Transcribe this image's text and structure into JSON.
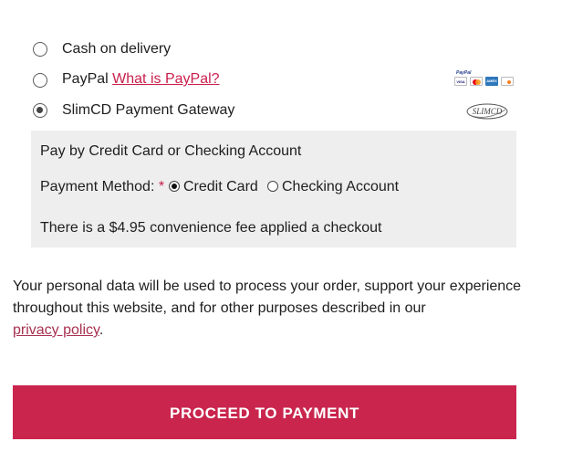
{
  "payment_options": [
    {
      "label": "Cash on delivery",
      "selected": false
    },
    {
      "label": "PayPal",
      "link_text": "What is PayPal?",
      "selected": false,
      "logo_text": "PayPal"
    },
    {
      "label": "SlimCD Payment Gateway",
      "selected": true,
      "logo_text": "SLIMCD"
    }
  ],
  "card_logos": {
    "visa": "VISA",
    "amex": "AMEX",
    "discover": "DISC"
  },
  "gateway": {
    "title": "Pay by Credit Card or Checking Account",
    "method_label": "Payment Method:",
    "required_mark": "*",
    "methods": [
      {
        "label": "Credit Card",
        "selected": true
      },
      {
        "label": "Checking Account",
        "selected": false
      }
    ],
    "fee_note": "There is a $4.95 convenience fee applied a checkout"
  },
  "privacy": {
    "text": "Your personal data will be used to process your order, support your experience throughout this website, and for other purposes described in our",
    "link_text": "privacy policy",
    "suffix": "."
  },
  "proceed_button": {
    "label": "PROCEED TO PAYMENT"
  },
  "colors": {
    "accent": "#c9254d",
    "link": "#c91f4b",
    "box_bg": "#eeeeee"
  }
}
